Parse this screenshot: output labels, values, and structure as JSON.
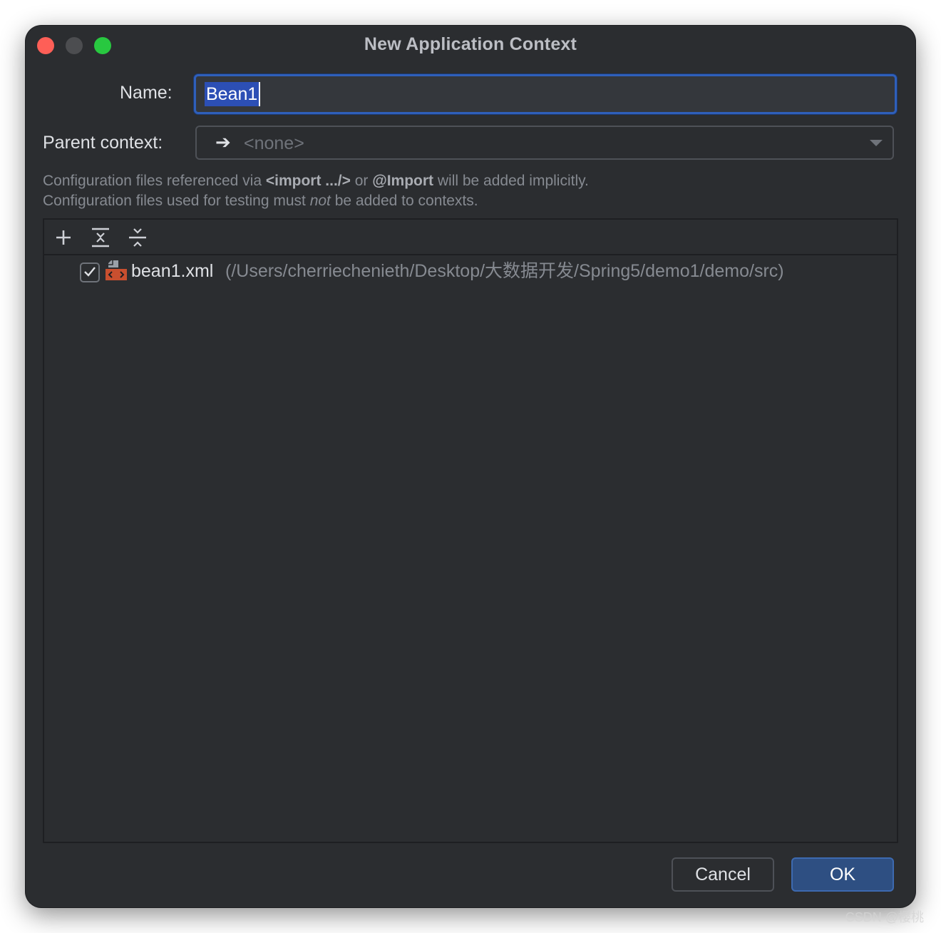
{
  "window": {
    "title": "New Application Context"
  },
  "form": {
    "name_label": "Name:",
    "name_value": "Bean1",
    "parent_label": "Parent context:",
    "parent_value": "<none>"
  },
  "hints": {
    "line1": {
      "p1": "Configuration files referenced via ",
      "b1": "<import .../>",
      "p2": " or ",
      "b2": "@Import",
      "p3": " will be added implicitly."
    },
    "line2": {
      "p1": "Configuration files used for testing must ",
      "em": "not",
      "p2": " be added to contexts."
    }
  },
  "toolbar": {
    "icons": [
      "add-icon",
      "expand-all-icon",
      "collapse-all-icon"
    ]
  },
  "files": [
    {
      "checked": true,
      "name": "bean1.xml",
      "path": "(/Users/cherriechenieth/Desktop/大数据开发/Spring5/demo1/demo/src)"
    }
  ],
  "buttons": {
    "cancel": "Cancel",
    "ok": "OK"
  },
  "colors": {
    "background": "#2b2d30",
    "accent": "#2e4f82",
    "selection": "#2c4fb5",
    "xml_icon": "#c94f2f"
  },
  "watermark": "CSDN @樱桃"
}
